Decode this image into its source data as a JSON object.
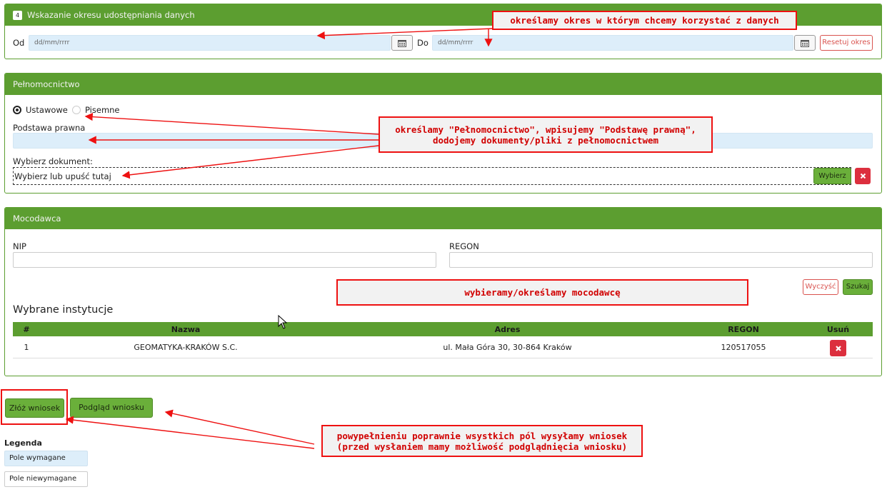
{
  "section_period": {
    "step_number": "4",
    "title": "Wskazanie okresu udostępniania danych",
    "from_label": "Od",
    "from_placeholder": "dd/mm/rrrr",
    "to_label": "Do",
    "to_placeholder": "dd/mm/rrrr",
    "reset_label": "Resetuj okres"
  },
  "section_poa": {
    "title": "Pełnomocnictwo",
    "radio_ustawowe": "Ustawowe",
    "radio_pisemne": "Pisemne",
    "selected": "Ustawowe",
    "legal_basis_label": "Podstawa prawna",
    "choose_doc_label": "Wybierz dokument:",
    "dropzone_text": "Wybierz lub upuść tutaj",
    "choose_button": "Wybierz"
  },
  "section_principal": {
    "title": "Mocodawca",
    "nip_label": "NIP",
    "regon_label": "REGON",
    "clear_button": "Wyczyść",
    "search_button": "Szukaj",
    "selected_title": "Wybrane instytucje",
    "table": {
      "headers": [
        "#",
        "Nazwa",
        "Adres",
        "REGON",
        "Usuń"
      ],
      "rows": [
        {
          "num": "1",
          "name": "GEOMATYKA-KRAKÓW S.C.",
          "address": "ul. Mała Góra 30, 30-864 Kraków",
          "regon": "120517055"
        }
      ]
    }
  },
  "actions": {
    "submit": "Złóż wniosek",
    "preview": "Podgląd wniosku"
  },
  "legend": {
    "title": "Legenda",
    "required": "Pole wymagane",
    "optional": "Pole niewymagane"
  },
  "annotations": {
    "period": "określamy okres w którym chcemy korzystać z danych",
    "poa_line1": "określamy \"Pełnomocnictwo\", wpisujemy \"Podstawę prawną\",",
    "poa_line2": "dodojemy dokumenty/pliki z pełnomocnictwem",
    "principal": "wybieramy/określamy mocodawcę",
    "submit_line1": "powypełnieniu poprawnie wsystkich pól wysyłamy wniosek",
    "submit_line2": "(przed wysłaniem mamy możliwość podglądnięcia wniosku)"
  },
  "colors": {
    "panel_green": "#5c9e30",
    "required_field": "#ddeefa",
    "annotation_red": "#e11111",
    "delete_red": "#dc2f3e"
  }
}
